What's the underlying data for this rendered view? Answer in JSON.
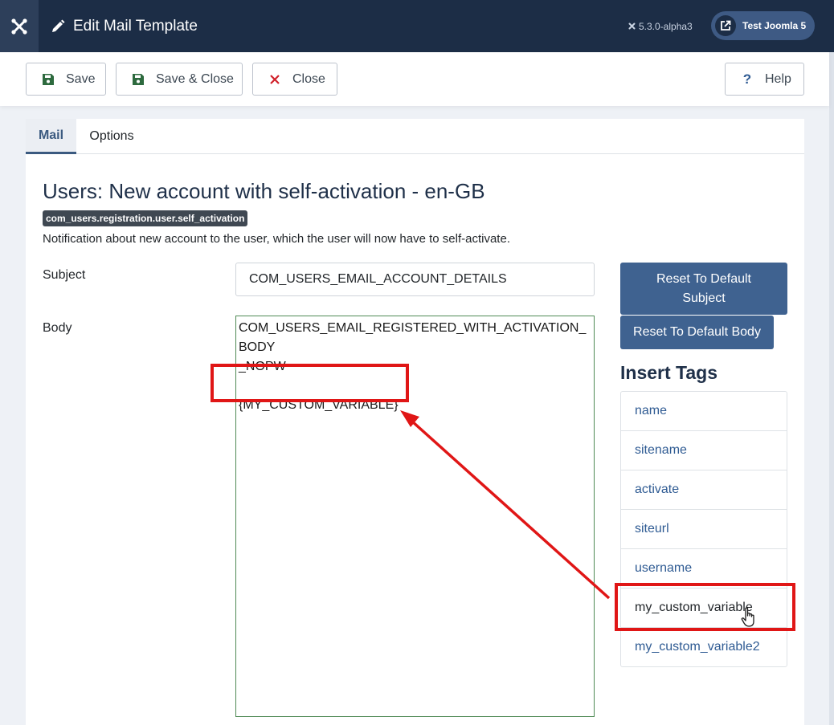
{
  "header": {
    "title": "Edit Mail Template",
    "version": "5.3.0-alpha3",
    "site_name": "Test Joomla 5"
  },
  "toolbar": {
    "save_label": "Save",
    "save_close_label": "Save & Close",
    "close_label": "Close",
    "help_label": "Help"
  },
  "tabs": [
    {
      "label": "Mail",
      "active": true
    },
    {
      "label": "Options",
      "active": false
    }
  ],
  "template": {
    "title": "Users: New account with self-activation - en-GB",
    "key_badge": "com_users.registration.user.self_activation",
    "description": "Notification about new account to the user, which the user will now have to self-activate."
  },
  "form": {
    "subject_label": "Subject",
    "subject_value": "COM_USERS_EMAIL_ACCOUNT_DETAILS",
    "body_label": "Body",
    "body_lines": [
      "COM_USERS_EMAIL_REGISTERED_WITH_ACTIVATION_BODY",
      "_NOPW",
      "",
      "{MY_CUSTOM_VARIABLE}"
    ],
    "reset_subject_label": "Reset To Default Subject",
    "reset_body_label": "Reset To Default Body"
  },
  "insert_tags": {
    "heading": "Insert Tags",
    "items": [
      "name",
      "sitename",
      "activate",
      "siteurl",
      "username",
      "my_custom_variable",
      "my_custom_variable2"
    ]
  },
  "colors": {
    "header_bg": "#1c2d46",
    "accent": "#3f6290",
    "annotation": "#e01616",
    "link": "#2f5b93"
  }
}
